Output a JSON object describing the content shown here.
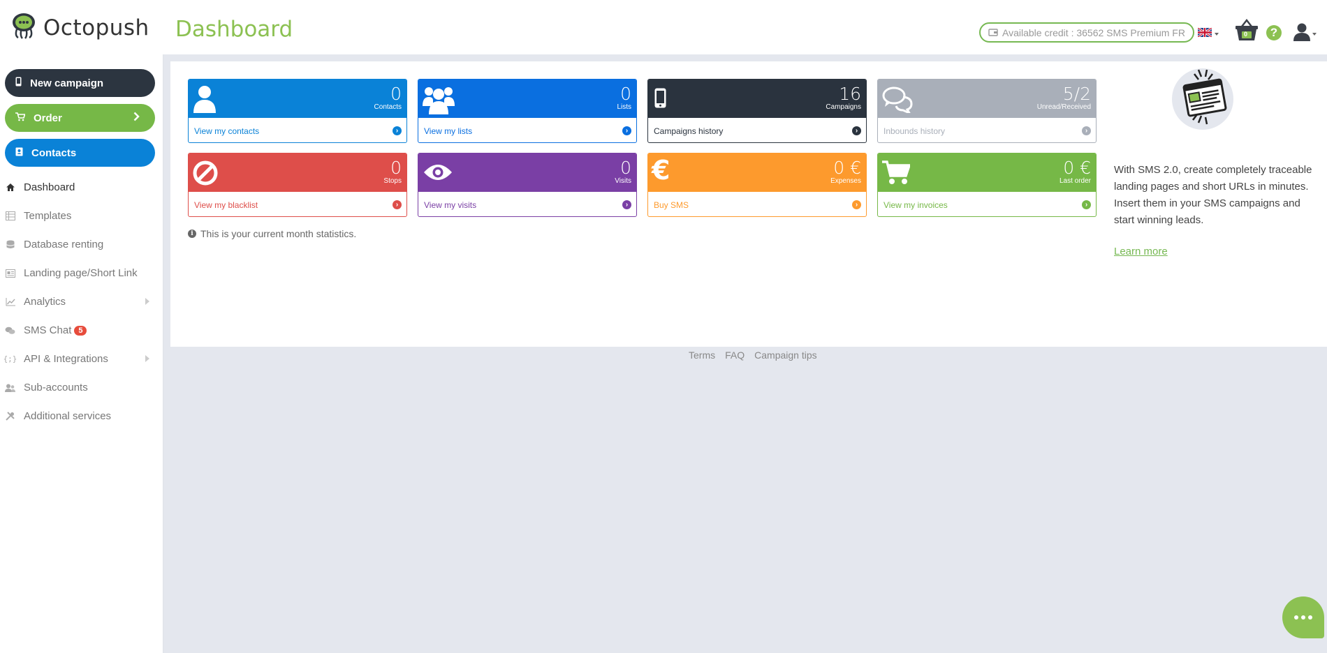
{
  "header": {
    "logo_text": "Octopush",
    "page_title": "Dashboard",
    "credit_text": "Available credit : 36562 SMS Premium FR",
    "basket_count": "0",
    "language_flag": "uk-flag-icon"
  },
  "sidebar": {
    "buttons": {
      "new_campaign": "New campaign",
      "order": "Order",
      "contacts": "Contacts"
    },
    "items": [
      {
        "label": "Dashboard",
        "icon": "home-icon"
      },
      {
        "label": "Templates",
        "icon": "templates-icon"
      },
      {
        "label": "Database renting",
        "icon": "database-icon"
      },
      {
        "label": "Landing page/Short Link",
        "icon": "landing-page-icon"
      },
      {
        "label": "Analytics",
        "icon": "chart-icon"
      },
      {
        "label": "SMS Chat",
        "icon": "chat-icon",
        "badge": "5"
      },
      {
        "label": "API & Integrations",
        "icon": "code-icon"
      },
      {
        "label": "Sub-accounts",
        "icon": "users-icon"
      },
      {
        "label": "Additional services",
        "icon": "tools-icon"
      }
    ]
  },
  "cards": [
    {
      "value": "0",
      "label": "Contacts",
      "link": "View my contacts",
      "color": "#0a82d7",
      "icon": "user-icon"
    },
    {
      "value": "0",
      "label": "Lists",
      "link": "View my lists",
      "color": "#0a6fe0",
      "icon": "users-group-icon"
    },
    {
      "value": "16",
      "label": "Campaigns",
      "link": "Campaigns history",
      "color": "#2a333e",
      "icon": "mobile-icon"
    },
    {
      "value": "5/2",
      "label": "Unread/Received",
      "link": "Inbounds history",
      "color": "#a9afb9",
      "icon": "comments-icon"
    },
    {
      "value": "0",
      "label": "Stops",
      "link": "View my blacklist",
      "color": "#de4e4a",
      "icon": "ban-icon"
    },
    {
      "value": "0",
      "label": "Visits",
      "link": "View my visits",
      "color": "#7a3fa5",
      "icon": "eye-icon"
    },
    {
      "value": "0 €",
      "label": "Expenses",
      "link": "Buy SMS",
      "color": "#fd9a2d",
      "icon": "euro-icon"
    },
    {
      "value": "0 €",
      "label": "Last order",
      "link": "View my invoices",
      "color": "#76b847",
      "icon": "cart-icon"
    }
  ],
  "stats_note": "This is your current month statistics.",
  "promo": {
    "text": "With SMS 2.0, create completely traceable landing pages and short URLs in minutes. Insert them in your SMS campaigns and start winning leads.",
    "link": "Learn more"
  },
  "footer": {
    "terms": "Terms",
    "faq": "FAQ",
    "tips": "Campaign tips"
  }
}
